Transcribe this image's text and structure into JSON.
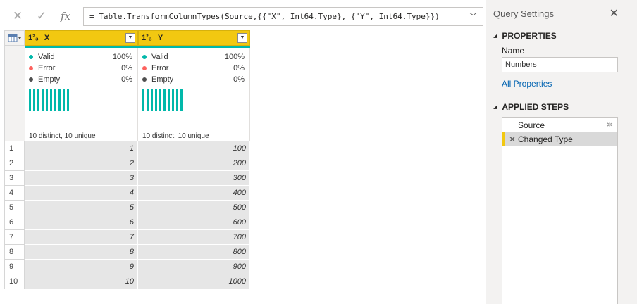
{
  "formula_bar": {
    "cancel_icon": "close-icon",
    "confirm_icon": "checkmark-icon",
    "fx_label": "fx",
    "formula": "= Table.TransformColumnTypes(Source,{{\"X\", Int64.Type}, {\"Y\", Int64.Type}})"
  },
  "columns": [
    {
      "type_label": "1²₃",
      "name": "X",
      "profile": {
        "valid_label": "Valid",
        "valid_pct": "100%",
        "error_label": "Error",
        "error_pct": "0%",
        "empty_label": "Empty",
        "empty_pct": "0%",
        "distinct": "10 distinct, 10 unique"
      }
    },
    {
      "type_label": "1²₃",
      "name": "Y",
      "profile": {
        "valid_label": "Valid",
        "valid_pct": "100%",
        "error_label": "Error",
        "error_pct": "0%",
        "empty_label": "Empty",
        "empty_pct": "0%",
        "distinct": "10 distinct, 10 unique"
      }
    }
  ],
  "rows": [
    {
      "n": "1",
      "x": "1",
      "y": "100"
    },
    {
      "n": "2",
      "x": "2",
      "y": "200"
    },
    {
      "n": "3",
      "x": "3",
      "y": "300"
    },
    {
      "n": "4",
      "x": "4",
      "y": "400"
    },
    {
      "n": "5",
      "x": "5",
      "y": "500"
    },
    {
      "n": "6",
      "x": "6",
      "y": "600"
    },
    {
      "n": "7",
      "x": "7",
      "y": "700"
    },
    {
      "n": "8",
      "x": "8",
      "y": "800"
    },
    {
      "n": "9",
      "x": "9",
      "y": "900"
    },
    {
      "n": "10",
      "x": "10",
      "y": "1000"
    }
  ],
  "colors": {
    "header_yellow": "#f2c811",
    "valid_teal": "#01b8aa",
    "error_red": "#fd625e",
    "empty_gray": "#4f4f4f",
    "link_blue": "#0063b1"
  },
  "query_settings": {
    "title": "Query Settings",
    "properties_heading": "PROPERTIES",
    "name_label": "Name",
    "name_value": "Numbers",
    "all_properties_link": "All Properties",
    "applied_steps_heading": "APPLIED STEPS",
    "steps": [
      {
        "label": "Source"
      },
      {
        "label": "Changed Type"
      }
    ]
  }
}
